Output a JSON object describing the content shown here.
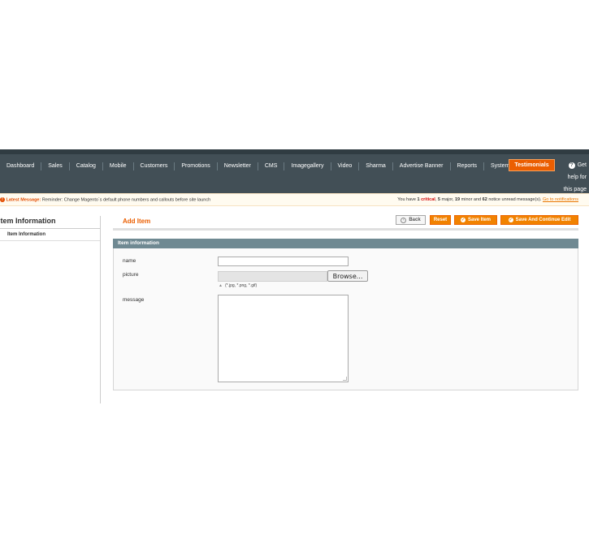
{
  "nav": {
    "items": [
      "Dashboard",
      "Sales",
      "Catalog",
      "Mobile",
      "Customers",
      "Promotions",
      "Newsletter",
      "CMS",
      "Imagegallery",
      "Video",
      "Sharma",
      "Advertise Banner",
      "Reports",
      "System"
    ],
    "active": "Testimonials",
    "help": "Get help for this page"
  },
  "message": {
    "icon": "!",
    "label": "Latest Message:",
    "text": "Reminder: Change Magento`s default phone numbers and callouts before site launch",
    "right_prefix": "You have",
    "critical_count": "1",
    "critical_label": "critical",
    "major": "5",
    "major_label": "major,",
    "minor": "19",
    "minor_label": "minor and",
    "notice": "62",
    "notice_label": "notice unread message(s).",
    "link": "Go to notifications"
  },
  "sidebar": {
    "title": "Item Information",
    "tab": "Item Information"
  },
  "content": {
    "title": "Add Item",
    "buttons": {
      "back": "Back",
      "reset": "Reset",
      "save": "Save Item",
      "save_continue": "Save And Continue Edit"
    }
  },
  "fieldset": {
    "legend": "Item information",
    "name_label": "name",
    "name_value": "",
    "picture_label": "picture",
    "browse": "Browse...",
    "picture_note": "(*.jpg, *.png, *.gif)",
    "message_label": "message",
    "message_value": ""
  },
  "colors": {
    "accent": "#eb5e00",
    "nav_bg": "#424f56",
    "fieldset_head": "#6f8992"
  }
}
